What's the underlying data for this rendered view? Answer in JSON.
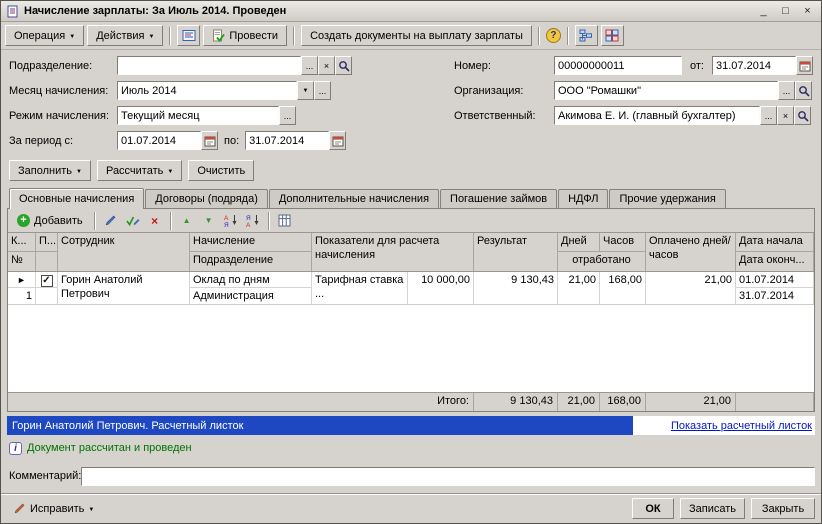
{
  "window": {
    "title": "Начисление зарплаты: За Июль 2014. Проведен"
  },
  "icons": {
    "dropdown": "▼",
    "ellipsis": "...",
    "clear": "×",
    "minimize": "_",
    "maximize": "□",
    "close": "×",
    "marker": "►",
    "check": "✓",
    "plus": "+",
    "help": "?",
    "info": "i",
    "up": "▲",
    "down": "▼",
    "delete": "×"
  },
  "toolbar": {
    "operation": "Операция",
    "actions": "Действия",
    "post": "Провести",
    "create_docs": "Создать документы на выплату зарплаты"
  },
  "form": {
    "department_label": "Подразделение:",
    "department_value": "",
    "month_label": "Месяц начисления:",
    "month_value": "Июль 2014",
    "mode_label": "Режим начисления:",
    "mode_value": "Текущий месяц",
    "period_label": "За период с:",
    "period_from": "01.07.2014",
    "period_to_label": "по:",
    "period_to": "31.07.2014",
    "number_label": "Номер:",
    "number_value": "00000000011",
    "number_from_label": "от:",
    "number_date": "31.07.2014",
    "org_label": "Организация:",
    "org_value": "ООО \"Ромашки\"",
    "resp_label": "Ответственный:",
    "resp_value": "Акимова Е. И. (главный бухгалтер)"
  },
  "actions_row": {
    "fill": "Заполнить",
    "calculate": "Рассчитать",
    "clear": "Очистить"
  },
  "tabs": [
    {
      "label": "Основные начисления"
    },
    {
      "label": "Договоры (подряда)"
    },
    {
      "label": "Дополнительные начисления"
    },
    {
      "label": "Погашение займов"
    },
    {
      "label": "НДФЛ"
    },
    {
      "label": "Прочие удержания"
    }
  ],
  "grid": {
    "add_label": "Добавить",
    "header": {
      "k": "К...",
      "num": "№",
      "p": "П...",
      "employee": "Сотрудник",
      "accrual": "Начисление",
      "department": "Подразделение",
      "indicators": "Показатели для расчета начисления",
      "result": "Результат",
      "days": "Дней",
      "hours": "Часов",
      "worked": "отработано",
      "paid": "Оплачено дней/часов",
      "date_start": "Дата начала",
      "date_end": "Дата оконч..."
    },
    "rows": [
      {
        "num": "1",
        "employee": "Горин Анатолий Петрович",
        "accrual": "Оклад по дням",
        "department": "Администрация",
        "indicator": "Тарифная ставка ...",
        "indicator_value": "10 000,00",
        "result": "9 130,43",
        "days": "21,00",
        "hours": "168,00",
        "paid": "21,00",
        "date_start": "01.07.2014",
        "date_end": "31.07.2014"
      }
    ],
    "total": {
      "label": "Итого:",
      "result": "9 130,43",
      "days": "21,00",
      "hours": "168,00",
      "paid": "21,00"
    }
  },
  "status": {
    "text": "Горин Анатолий Петрович. Расчетный листок",
    "link": "Показать расчетный листок"
  },
  "info": {
    "text": "Документ рассчитан и проведен"
  },
  "comment": {
    "label": "Комментарий:",
    "value": ""
  },
  "footer": {
    "fix": "Исправить",
    "ok": "ОК",
    "save": "Записать",
    "close": "Закрыть"
  }
}
